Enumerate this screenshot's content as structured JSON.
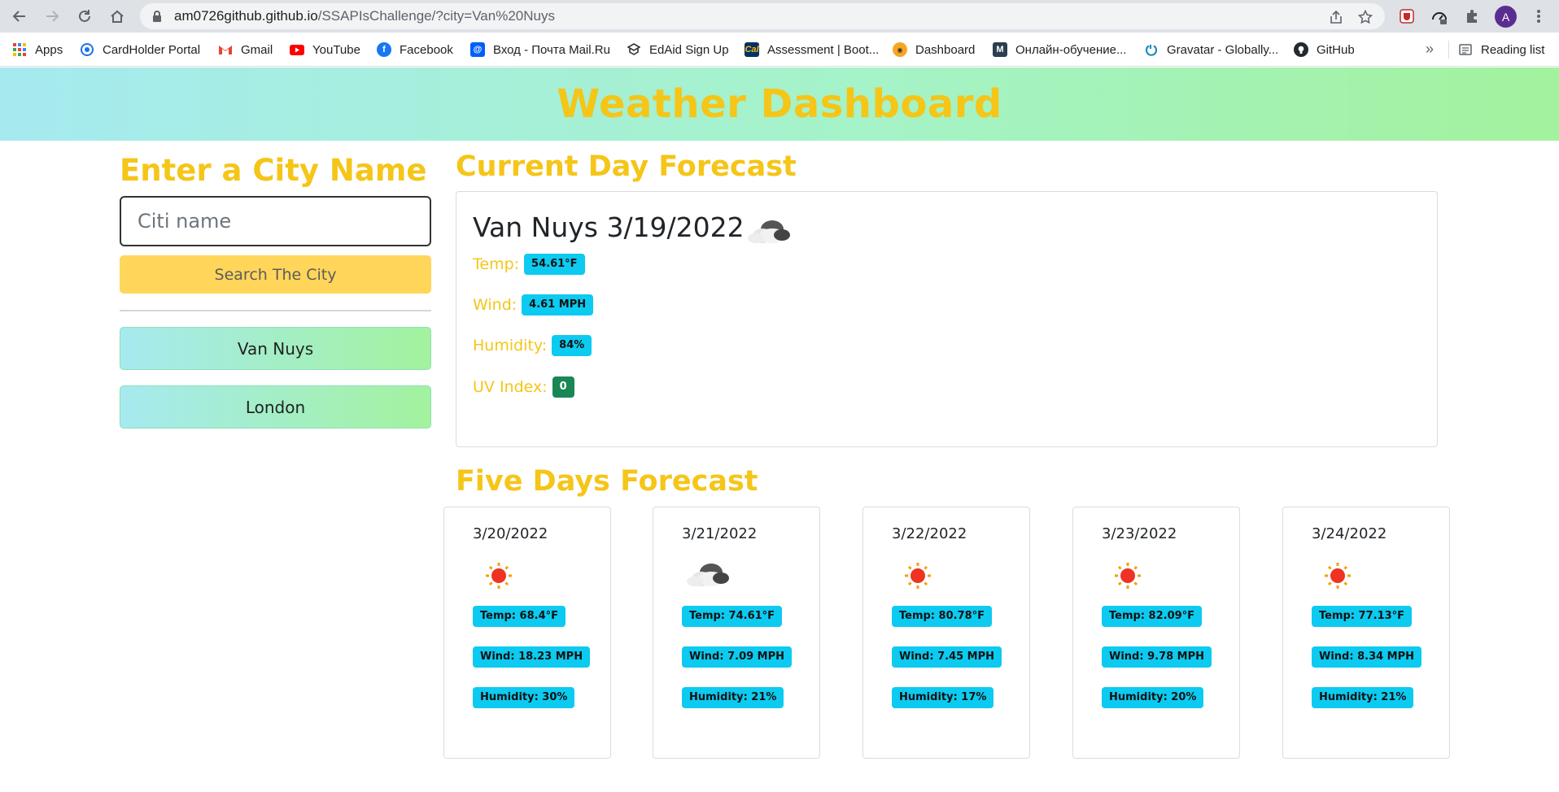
{
  "browser": {
    "url_host": "am0726github.github.io",
    "url_path": "/SSAPIsChallenge/?city=Van%20Nuys",
    "avatar_letter": "A",
    "bookmarks": [
      {
        "label": "Apps",
        "icon": "apps-grid-icon",
        "color": "#4285f4"
      },
      {
        "label": "CardHolder Portal",
        "icon": "cardholder-icon",
        "color": "#1a73e8"
      },
      {
        "label": "Gmail",
        "icon": "gmail-icon",
        "color": "#ea4335"
      },
      {
        "label": "YouTube",
        "icon": "youtube-icon",
        "color": "#ff0000"
      },
      {
        "label": "Facebook",
        "icon": "facebook-icon",
        "color": "#1877f2"
      },
      {
        "label": "Вход - Почта Mail.Ru",
        "icon": "mailru-icon",
        "color": "#005ff9"
      },
      {
        "label": "EdAid Sign Up",
        "icon": "edaid-icon",
        "color": "#333333"
      },
      {
        "label": "Assessment | Boot...",
        "icon": "berkeley-icon",
        "color": "#003262"
      },
      {
        "label": "Dashboard",
        "icon": "dashboard-icon",
        "color": "#f5a623"
      },
      {
        "label": "Онлайн-обучение...",
        "icon": "m-icon",
        "color": "#2c3e50"
      },
      {
        "label": "Gravatar - Globally...",
        "icon": "gravatar-icon",
        "color": "#1e8cbe"
      },
      {
        "label": "GitHub",
        "icon": "github-icon",
        "color": "#24292f"
      }
    ],
    "reading_list": "Reading list"
  },
  "header": {
    "title": "Weather Dashboard"
  },
  "search": {
    "title": "Enter a City Name",
    "placeholder": "Citi name",
    "button": "Search The City",
    "history": [
      "Van Nuys",
      "London"
    ]
  },
  "current": {
    "section_title": "Current Day Forecast",
    "city_date": "Van Nuys 3/19/2022",
    "icon": "cloud-icon",
    "temp_label": "Temp:",
    "temp": "54.61°F",
    "wind_label": "Wind:",
    "wind": "4.61 MPH",
    "humidity_label": "Humidity:",
    "humidity": "84%",
    "uv_label": "UV Index:",
    "uv": "0"
  },
  "forecast": {
    "section_title": "Five Days Forecast",
    "days": [
      {
        "date": "3/20/2022",
        "icon": "sun-icon",
        "temp": "Temp: 68.4°F",
        "wind": "Wind: 18.23 MPH",
        "humidity": "Humidity: 30%"
      },
      {
        "date": "3/21/2022",
        "icon": "cloud-icon",
        "temp": "Temp: 74.61°F",
        "wind": "Wind: 7.09 MPH",
        "humidity": "Humidity: 21%"
      },
      {
        "date": "3/22/2022",
        "icon": "sun-icon",
        "temp": "Temp: 80.78°F",
        "wind": "Wind: 7.45 MPH",
        "humidity": "Humidity: 17%"
      },
      {
        "date": "3/23/2022",
        "icon": "sun-icon",
        "temp": "Temp: 82.09°F",
        "wind": "Wind: 9.78 MPH",
        "humidity": "Humidity: 20%"
      },
      {
        "date": "3/24/2022",
        "icon": "sun-icon",
        "temp": "Temp: 77.13°F",
        "wind": "Wind: 8.34 MPH",
        "humidity": "Humidity: 21%"
      }
    ]
  },
  "colors": {
    "accent_yellow": "#f5c518",
    "badge_cyan": "#0dcaf0",
    "uv_green": "#198754",
    "button_yellow": "#ffd65a"
  }
}
